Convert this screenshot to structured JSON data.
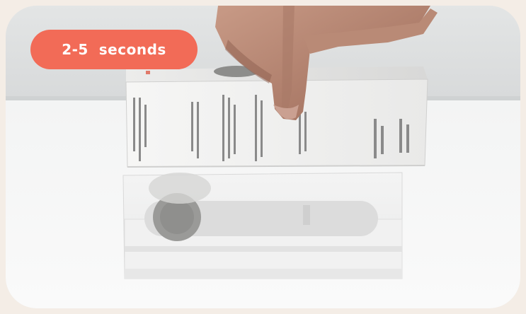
{
  "badge": {
    "label": "2-5  seconds",
    "color": "#f26b57"
  },
  "photo": {
    "subject": "hand-lifting-product-box-photo"
  }
}
